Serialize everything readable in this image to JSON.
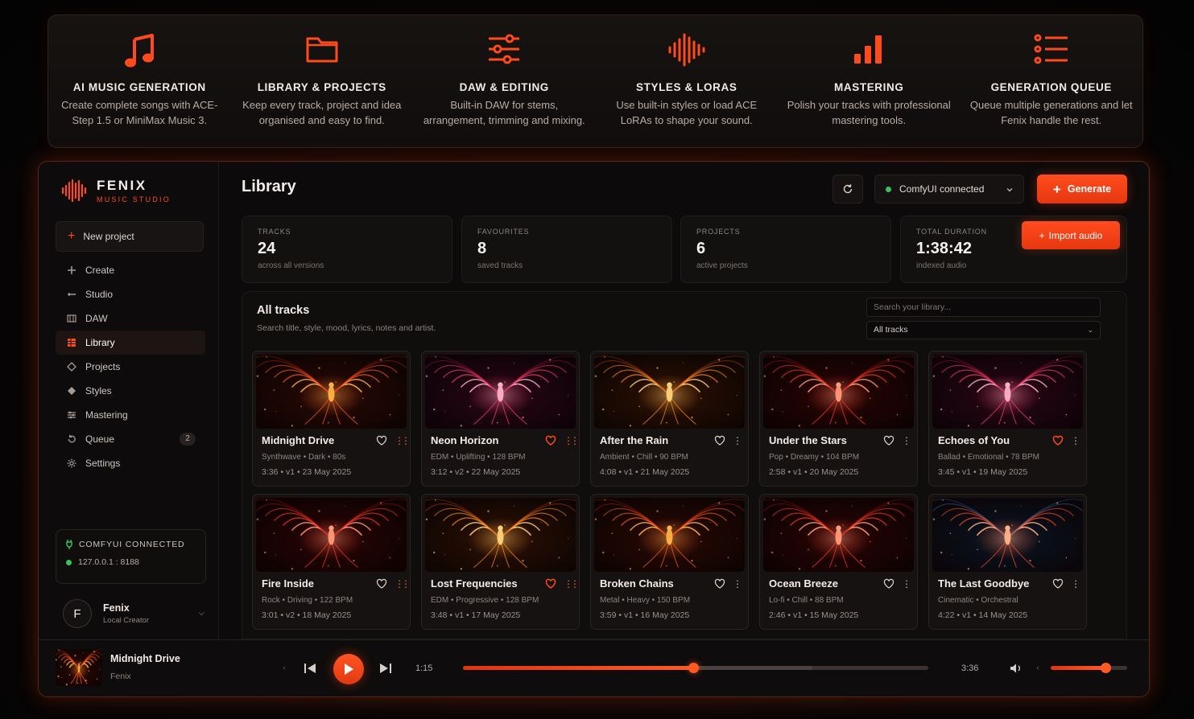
{
  "colors": {
    "accent": "#ff4a1c",
    "background": "#0c0a0a",
    "connected": "#3ac25a"
  },
  "features": [
    {
      "icon": "music-note-icon",
      "title": "AI MUSIC GENERATION",
      "desc": "Create complete songs with ACE-Step 1.5 or MiniMax Music 3."
    },
    {
      "icon": "folder-icon",
      "title": "LIBRARY & PROJECTS",
      "desc": "Keep every track, project and idea organised and easy to find."
    },
    {
      "icon": "sliders-icon",
      "title": "DAW & EDITING",
      "desc": "Built-in DAW for stems, arrangement, trimming and mixing."
    },
    {
      "icon": "waveform-icon",
      "title": "STYLES & LORAS",
      "desc": "Use built-in styles or load ACE LoRAs to shape your sound."
    },
    {
      "icon": "bar-chart-icon",
      "title": "MASTERING",
      "desc": "Polish your tracks with professional mastering tools."
    },
    {
      "icon": "list-icon",
      "title": "GENERATION QUEUE",
      "desc": "Queue multiple generations and let Fenix handle the rest."
    }
  ],
  "brand": {
    "name": "FENIX",
    "tagline": "MUSIC STUDIO",
    "logo_icon": "waveform-logo-icon"
  },
  "sidebar": {
    "new_project": "New project",
    "items": [
      {
        "label": "Create",
        "icon": "plus-icon"
      },
      {
        "label": "Studio",
        "icon": "studio-icon"
      },
      {
        "label": "DAW",
        "icon": "daw-icon"
      },
      {
        "label": "Library",
        "icon": "library-icon",
        "active": true
      },
      {
        "label": "Projects",
        "icon": "projects-icon"
      },
      {
        "label": "Styles",
        "icon": "styles-icon"
      },
      {
        "label": "Mastering",
        "icon": "mastering-icon"
      },
      {
        "label": "Queue",
        "icon": "queue-icon",
        "badge": "2"
      },
      {
        "label": "Settings",
        "icon": "gear-icon"
      }
    ],
    "status": {
      "label": "COMFYUI CONNECTED",
      "address": "127.0.0.1 : 8188"
    },
    "user": {
      "initial": "F",
      "name": "Fenix",
      "role": "Local Creator"
    }
  },
  "header": {
    "title": "Library",
    "connection": "ComfyUI connected",
    "generate": "Generate"
  },
  "stats": [
    {
      "label": "TRACKS",
      "value": "24",
      "sub": "across all versions"
    },
    {
      "label": "FAVOURITES",
      "value": "8",
      "sub": "saved tracks"
    },
    {
      "label": "PROJECTS",
      "value": "6",
      "sub": "active projects"
    },
    {
      "label": "TOTAL DURATION",
      "value": "1:38:42",
      "sub": "indexed audio"
    }
  ],
  "import_label": "Import audio",
  "tracks_panel": {
    "title": "All tracks",
    "subtitle": "Search title, style, mood, lyrics, notes and artist.",
    "search_placeholder": "Search your library...",
    "filter": "All tracks"
  },
  "tracks": [
    {
      "title": "Midnight Drive",
      "meta": "Synthwave • Dark • 80s",
      "info": "3:36  •  v1  •  23 May 2025",
      "fav": false,
      "palette": "orange"
    },
    {
      "title": "Neon Horizon",
      "meta": "EDM • Uplifting • 128 BPM",
      "info": "3:12  •  v2  •  22 May 2025",
      "fav": true,
      "palette": "pink"
    },
    {
      "title": "After the Rain",
      "meta": "Ambient • Chill • 90 BPM",
      "info": "4:08  •  v1  •  21 May 2025",
      "fav": false,
      "palette": "amber"
    },
    {
      "title": "Under the Stars",
      "meta": "Pop • Dreamy • 104 BPM",
      "info": "2:58  •  v1  •  20 May 2025",
      "fav": false,
      "palette": "red"
    },
    {
      "title": "Echoes of You",
      "meta": "Ballad • Emotional • 78 BPM",
      "info": "3:45  •  v1  •  19 May 2025",
      "fav": true,
      "palette": "pink"
    },
    {
      "title": "Fire Inside",
      "meta": "Rock • Driving • 122 BPM",
      "info": "3:01  •  v2  •  18 May 2025",
      "fav": false,
      "palette": "red"
    },
    {
      "title": "Lost Frequencies",
      "meta": "EDM • Progressive • 128 BPM",
      "info": "3:48  •  v1  •  17 May 2025",
      "fav": true,
      "palette": "amber"
    },
    {
      "title": "Broken Chains",
      "meta": "Metal • Heavy • 150 BPM",
      "info": "3:59  •  v1  •  16 May 2025",
      "fav": false,
      "palette": "orange"
    },
    {
      "title": "Ocean Breeze",
      "meta": "Lo-fi • Chill • 88 BPM",
      "info": "2:46  •  v1  •  15 May 2025",
      "fav": false,
      "palette": "red"
    },
    {
      "title": "The Last Goodbye",
      "meta": "Cinematic • Orchestral",
      "info": "4:22  •  v1  •  14 May 2025",
      "fav": false,
      "palette": "blue"
    }
  ],
  "player": {
    "title": "Midnight Drive",
    "artist": "Fenix",
    "current": "1:15",
    "total": "3:36",
    "progress": 0.495,
    "buffered": 0.75,
    "volume": 0.72
  }
}
